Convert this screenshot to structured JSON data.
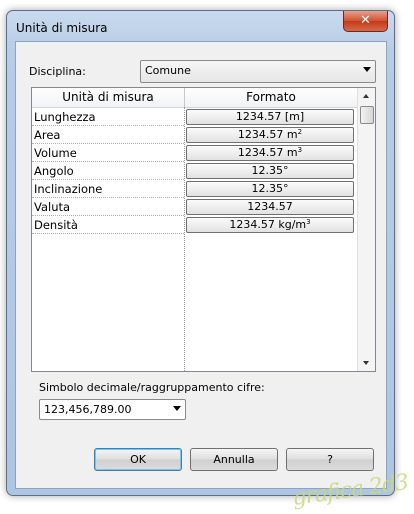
{
  "window": {
    "title": "Unità di misura",
    "close_glyph": "✕"
  },
  "discipline": {
    "label": "Disciplina:",
    "value": "Comune"
  },
  "table": {
    "headers": [
      "Unità di misura",
      "Formato"
    ],
    "rows": [
      {
        "name": "Lunghezza",
        "format": "1234.57 [m]",
        "sup": ""
      },
      {
        "name": "Area",
        "format": "1234.57 m",
        "sup": "2"
      },
      {
        "name": "Volume",
        "format": "1234.57 m",
        "sup": "3"
      },
      {
        "name": "Angolo",
        "format": "12.35°",
        "sup": ""
      },
      {
        "name": "Inclinazione",
        "format": "12.35°",
        "sup": ""
      },
      {
        "name": "Valuta",
        "format": "1234.57",
        "sup": ""
      },
      {
        "name": "Densità",
        "format": "1234.57 kg/m",
        "sup": "3"
      }
    ]
  },
  "decimal": {
    "label": "Simbolo decimale/raggruppamento cifre:",
    "value": "123,456,789.00"
  },
  "buttons": {
    "ok": "OK",
    "cancel": "Annulla",
    "help": "?"
  },
  "watermark": "grafica 2d3"
}
